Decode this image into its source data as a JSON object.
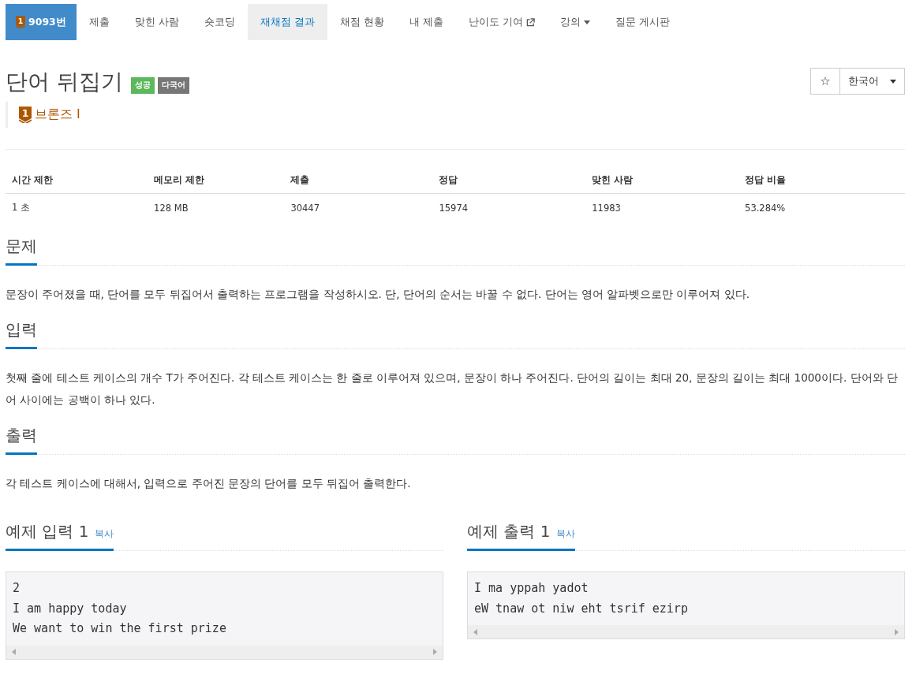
{
  "nav": {
    "tier_number": "1",
    "tabs": [
      {
        "label": "9093번",
        "kind": "problem",
        "selected": true,
        "highlighted": false
      },
      {
        "label": "제출",
        "kind": "link",
        "selected": false,
        "highlighted": false
      },
      {
        "label": "맞힌 사람",
        "kind": "link",
        "selected": false,
        "highlighted": false
      },
      {
        "label": "숏코딩",
        "kind": "link",
        "selected": false,
        "highlighted": false
      },
      {
        "label": "재채점 결과",
        "kind": "link",
        "selected": false,
        "highlighted": true
      },
      {
        "label": "채점 현황",
        "kind": "link",
        "selected": false,
        "highlighted": false
      },
      {
        "label": "내 제출",
        "kind": "link",
        "selected": false,
        "highlighted": false
      },
      {
        "label": "난이도 기여",
        "kind": "external",
        "selected": false,
        "highlighted": false
      },
      {
        "label": "강의",
        "kind": "dropdown",
        "selected": false,
        "highlighted": false
      },
      {
        "label": "질문 게시판",
        "kind": "link",
        "selected": false,
        "highlighted": false
      }
    ]
  },
  "title": "단어 뒤집기",
  "labels": [
    {
      "text": "성공",
      "color": "#5cb85c"
    },
    {
      "text": "다국어",
      "color": "#777777"
    }
  ],
  "tier": {
    "number": "1",
    "text": "브론즈 I"
  },
  "language": {
    "label": "한국어",
    "star": "☆"
  },
  "stats": {
    "columns": [
      "시간 제한",
      "메모리 제한",
      "제출",
      "정답",
      "맞힌 사람",
      "정답 비율"
    ],
    "row": [
      "1 초",
      "128 MB",
      "30447",
      "15974",
      "11983",
      "53.284%"
    ]
  },
  "sections": [
    {
      "title": "문제",
      "paragraphs": [
        "문장이 주어졌을 때, 단어를 모두 뒤집어서 출력하는 프로그램을 작성하시오. 단, 단어의 순서는 바꿀 수 없다. 단어는 영어 알파벳으로만 이루어져 있다."
      ]
    },
    {
      "title": "입력",
      "paragraphs": [
        "첫째 줄에 테스트 케이스의 개수 T가 주어진다. 각 테스트 케이스는 한 줄로 이루어져 있으며, 문장이 하나 주어진다. 단어의 길이는 최대 20, 문장의 길이는 최대 1000이다. 단어와 단어 사이에는 공백이 하나 있다."
      ]
    },
    {
      "title": "출력",
      "paragraphs": [
        "각 테스트 케이스에 대해서, 입력으로 주어진 문장의 단어를 모두 뒤집어 출력한다."
      ]
    }
  ],
  "samples": [
    {
      "title": "예제 입력 1",
      "copy": "복사",
      "lines": [
        "2",
        "I am happy today",
        "We want to win the first prize"
      ]
    },
    {
      "title": "예제 출력 1",
      "copy": "복사",
      "lines": [
        "I ma yppah yadot",
        "eW tnaw ot niw eht tsrif ezirp"
      ]
    }
  ]
}
